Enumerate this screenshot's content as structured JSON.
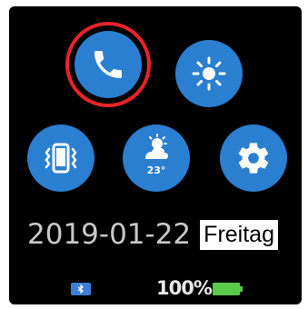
{
  "screen": {
    "apps": [
      {
        "id": "phone",
        "icon": "phone-icon",
        "selected": true
      },
      {
        "id": "brightness",
        "icon": "sun-icon"
      },
      {
        "id": "vibrate",
        "icon": "vibrate-phone-icon"
      },
      {
        "id": "weather",
        "icon": "weather-icon",
        "temperature": "23°"
      },
      {
        "id": "settings",
        "icon": "gear-icon"
      }
    ],
    "date": "2019-01-22",
    "weekday": "Freitag",
    "status": {
      "bluetooth_icon": "bluetooth-icon",
      "battery_percent_label": "100%",
      "battery_level": 1.0
    }
  },
  "colors": {
    "background": "#000000",
    "button_blue": "#2a7fd1",
    "highlight_red": "#e8232b",
    "battery_green": "#5ac94e",
    "bluetooth_blue": "#3b7fd6",
    "date_gray": "#c9c9c9"
  }
}
